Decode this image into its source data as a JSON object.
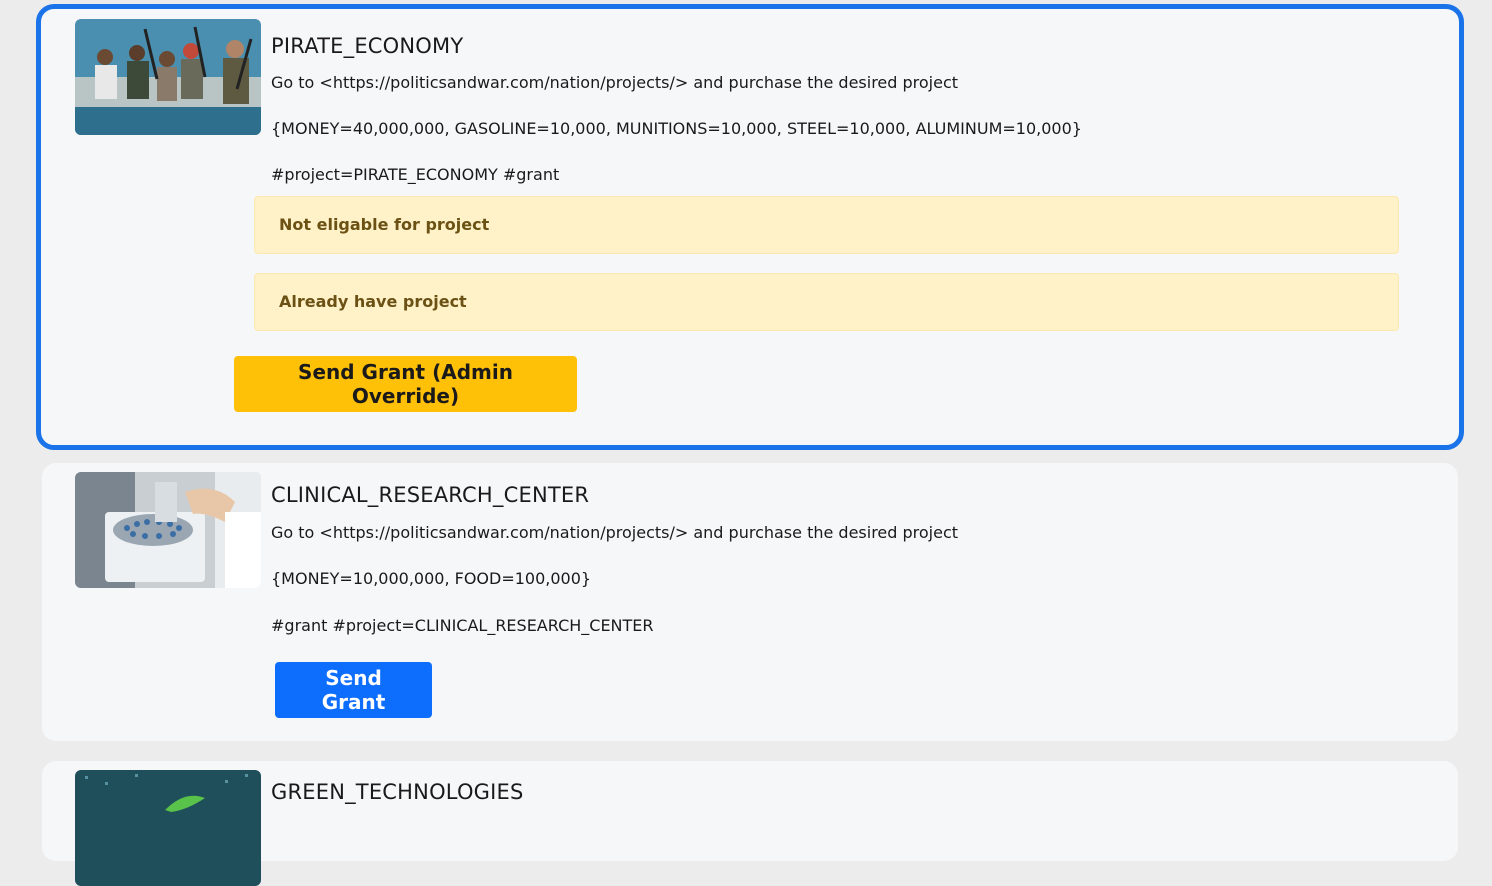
{
  "projects": [
    {
      "title": "PIRATE_ECONOMY",
      "instruction": "Go to <https://politicsandwar.com/nation/projects/> and purchase the desired project",
      "cost": "{MONEY=40,000,000, GASOLINE=10,000, MUNITIONS=10,000, STEEL=10,000, ALUMINUM=10,000}",
      "tags": "#project=PIRATE_ECONOMY #grant",
      "alerts": [
        "Not eligable for project",
        "Already have project"
      ],
      "button_label": "Send Grant (Admin Override)",
      "button_color": "#ffc008",
      "selected": true
    },
    {
      "title": "CLINICAL_RESEARCH_CENTER",
      "instruction": "Go to <https://politicsandwar.com/nation/projects/> and purchase the desired project",
      "cost": "{MONEY=10,000,000, FOOD=100,000}",
      "tags": "#grant #project=CLINICAL_RESEARCH_CENTER",
      "button_label": "Send Grant",
      "button_color": "#0d6efd"
    },
    {
      "title": "GREEN_TECHNOLOGIES"
    }
  ],
  "colors": {
    "selection_border": "#1a73e8",
    "alert_bg": "#fff1c8",
    "alert_text": "#6b5214"
  }
}
